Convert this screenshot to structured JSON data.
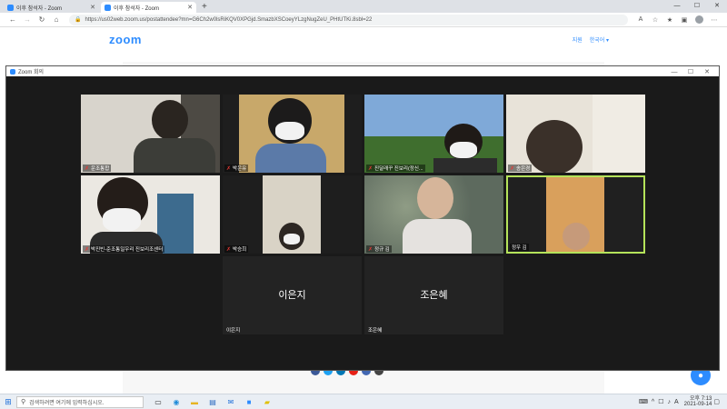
{
  "browser": {
    "tabs": [
      {
        "label": "이후 참석자 - Zoom",
        "active": false
      },
      {
        "label": "이후 참석자 - Zoom",
        "active": true
      }
    ],
    "new_tab": "+",
    "url": "https://us02web.zoom.us/postattendee?mn=G6Ch2w0lsRiKQV0XPGjd.SmazbXSCoeyYLzgNugZeU_PHtUTKi.8sbl=22"
  },
  "site": {
    "logo": "zoom",
    "nav_support": "지원",
    "nav_language": "한국어 ▾"
  },
  "zoom_window": {
    "title": "Zoom 회의",
    "participants": [
      {
        "name": "운조통합"
      },
      {
        "name": "박은유"
      },
      {
        "name": "진달래꾸 진보리(정신..."
      },
      {
        "name": "송은경"
      },
      {
        "name": "박진빈-준조통일우리 진보리조센터"
      },
      {
        "name": "박승희"
      },
      {
        "name": "정규 김"
      },
      {
        "name": "정우 김"
      },
      {
        "name": "이은지",
        "display": "이은지"
      },
      {
        "name": "조은혜",
        "display": "조은혜"
      }
    ]
  },
  "taskbar": {
    "search_placeholder": "검색하려면 여기에 입력하십시오.",
    "time": "오후 7:13",
    "date": "2021-09-14"
  },
  "colors": {
    "zoom_blue": "#2d8cff",
    "active_speaker": "#b5e35a",
    "muted": "#e53935"
  }
}
